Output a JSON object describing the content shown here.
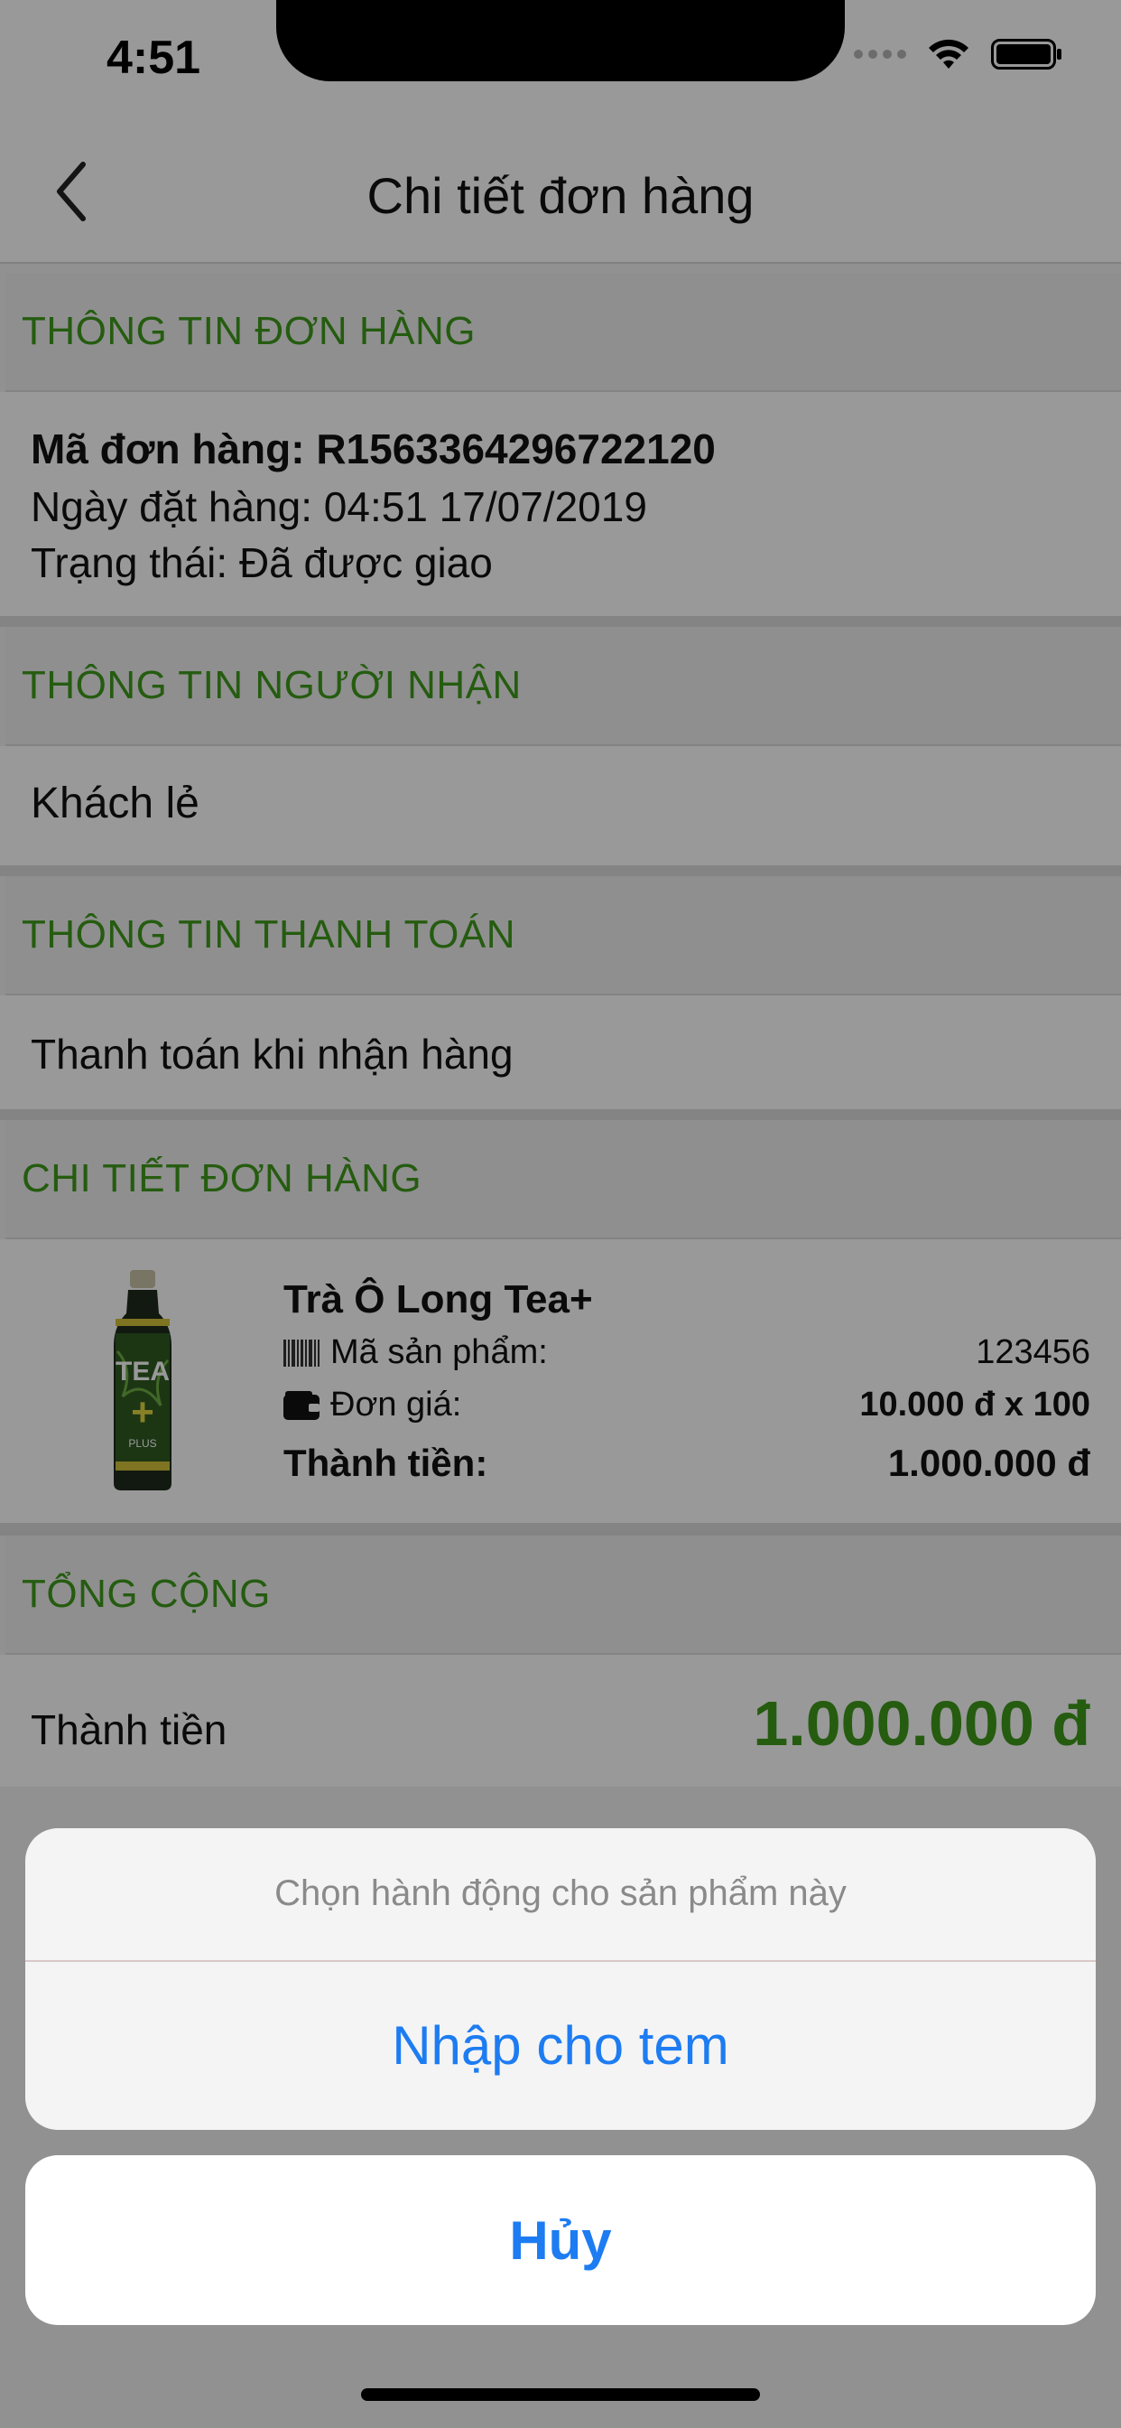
{
  "status_bar": {
    "time": "4:51"
  },
  "nav": {
    "title": "Chi tiết đơn hàng"
  },
  "order_info": {
    "header": "THÔNG TIN ĐƠN HÀNG",
    "order_code": "Mã đơn hàng: R1563364296722120",
    "order_date": "Ngày đặt hàng: 04:51 17/07/2019",
    "status": "Trạng thái: Đã được giao"
  },
  "recipient": {
    "header": "THÔNG TIN NGƯỜI NHẬN",
    "name": "Khách lẻ"
  },
  "payment": {
    "header": "THÔNG TIN THANH TOÁN",
    "method": "Thanh toán khi nhận hàng"
  },
  "order_detail": {
    "header": "CHI TIẾT ĐƠN HÀNG",
    "product": {
      "name": "Trà Ô Long Tea+",
      "code_label": "Mã sản phẩm:",
      "code_value": "123456",
      "price_label": "Đơn giá:",
      "price_value": "10.000 đ x 100",
      "subtotal_label": "Thành tiền:",
      "subtotal_value": "1.000.000 đ",
      "bottle_text": "TEA",
      "bottle_plus": "+",
      "bottle_plus_word": "PLUS"
    }
  },
  "total": {
    "header": "TỔNG CỘNG",
    "label": "Thành tiền",
    "value": "1.000.000 đ"
  },
  "action_sheet": {
    "title": "Chọn hành động cho sản phẩm này",
    "action": "Nhập cho tem",
    "cancel": "Hủy"
  },
  "colors": {
    "accent_green": "#3f9a1c",
    "ios_blue": "#1d7cf2"
  }
}
